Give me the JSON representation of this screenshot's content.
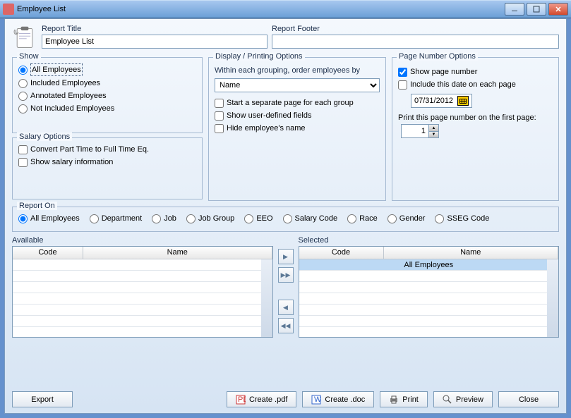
{
  "title": "Employee List",
  "header": {
    "report_title_label": "Report Title",
    "report_title_value": "Employee List",
    "report_footer_label": "Report Footer",
    "report_footer_value": ""
  },
  "show": {
    "legend": "Show",
    "all": "All Employees",
    "included": "Included Employees",
    "annotated": "Annotated Employees",
    "not_included": "Not Included Employees"
  },
  "salary": {
    "legend": "Salary Options",
    "convert": "Convert Part Time to Full Time Eq.",
    "show_info": "Show salary information"
  },
  "display": {
    "legend": "Display / Printing Options",
    "order_label": "Within each grouping, order employees by",
    "order_value": "Name",
    "separate": "Start a separate page for each group",
    "udf": "Show user-defined fields",
    "hide_name": "Hide employee's name"
  },
  "pagenum": {
    "legend": "Page Number Options",
    "show": "Show page number",
    "include_date": "Include this date on each page",
    "date": "07/31/2012",
    "print_first_label": "Print this page number on the first page:",
    "first_value": "1"
  },
  "report_on": {
    "legend": "Report On",
    "options": [
      "All Employees",
      "Department",
      "Job",
      "Job Group",
      "EEO",
      "Salary Code",
      "Race",
      "Gender",
      "SSEG Code"
    ]
  },
  "available": {
    "label": "Available",
    "cols": [
      "Code",
      "Name"
    ]
  },
  "selected": {
    "label": "Selected",
    "cols": [
      "Code",
      "Name"
    ],
    "row": "All Employees"
  },
  "footer": {
    "export": "Export",
    "create_pdf": "Create .pdf",
    "create_doc": "Create .doc",
    "print": "Print",
    "preview": "Preview",
    "close": "Close"
  }
}
